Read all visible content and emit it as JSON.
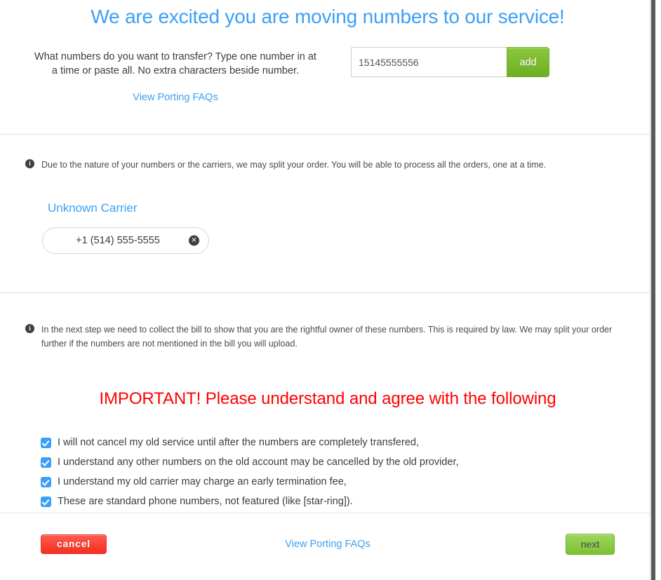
{
  "header": {
    "title": "We are excited you are moving numbers to our service!",
    "prompt": "What numbers do you want to transfer? Type one number in at a time or paste all. No extra characters beside number.",
    "faq_link": "View Porting FAQs",
    "number_input_value": "15145555556",
    "number_input_placeholder": "",
    "add_button_label": "add"
  },
  "carrier_section": {
    "info_icon": "info-icon",
    "info_text": "Due to the nature of your numbers or the carriers, we may split your order. You will be able to process all the orders, one at a time.",
    "carrier_name": "Unknown Carrier",
    "numbers": [
      {
        "label": "+1 (514) 555-5555",
        "remove_icon": "remove-circle-icon"
      }
    ]
  },
  "agreement_section": {
    "info_icon": "info-icon",
    "info_text": "In the next step we need to collect the bill to show that you are the rightful owner of these numbers. This is required by law. We may split your order further if the numbers are not mentioned in the bill you will upload.",
    "important_title": "IMPORTANT! Please understand and agree with the following",
    "items": [
      {
        "label": "I will not cancel my old service until after the numbers are completely transfered,",
        "checked": true
      },
      {
        "label": "I understand any other numbers on the old account may be cancelled by the old provider,",
        "checked": true
      },
      {
        "label": "I understand my old carrier may charge an early termination fee,",
        "checked": true
      },
      {
        "label": "These are standard phone numbers, not featured (like [star-ring]).",
        "checked": true
      }
    ]
  },
  "footer": {
    "cancel_label": "cancel",
    "faq_link": "View Porting FAQs",
    "next_label": "next"
  },
  "colors": {
    "accent_blue": "#3ba0f5",
    "important_red": "#ff0000",
    "green_button": "#8bc63f",
    "cancel_red": "#fa4135",
    "divider": "#e2e2e2",
    "info_dark": "#3f3f3f"
  }
}
